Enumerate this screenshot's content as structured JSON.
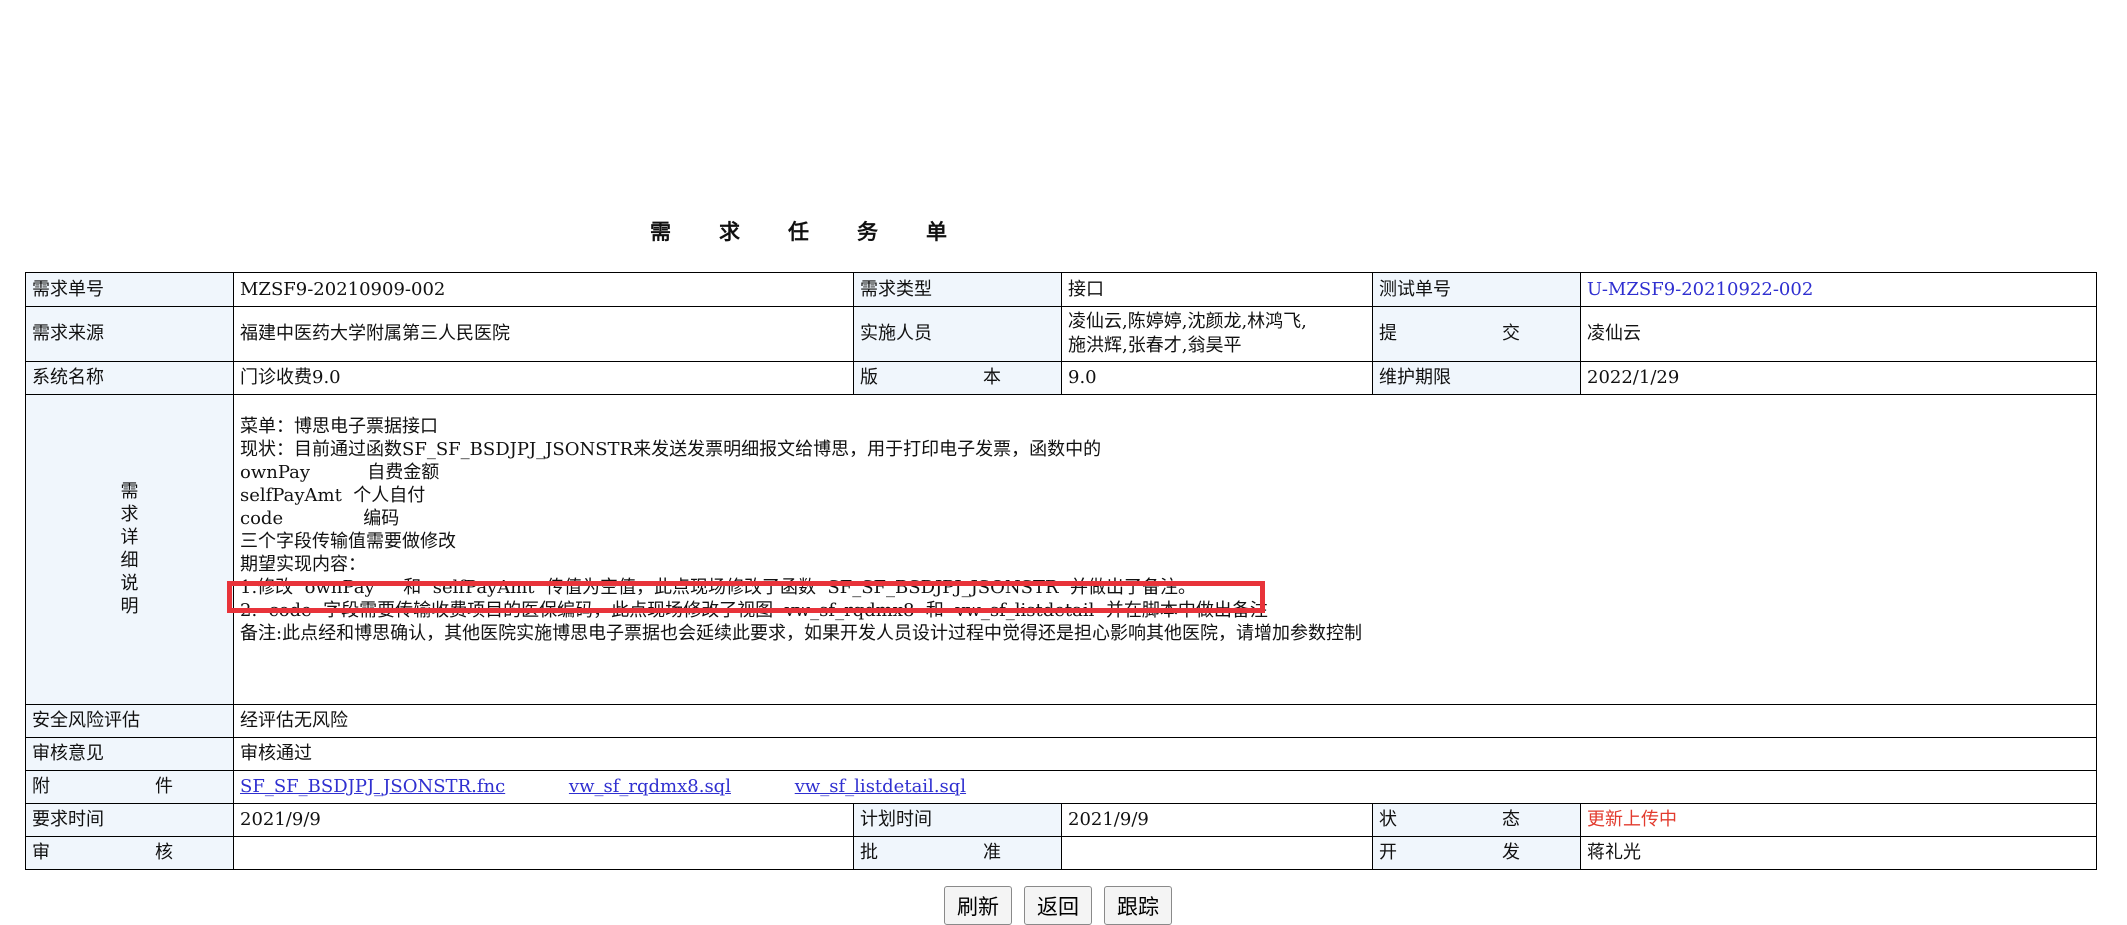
{
  "title": "需求任务单",
  "row1": {
    "req_no_label": "需求单号",
    "req_no": "MZSF9-20210909-002",
    "req_type_label": "需求类型",
    "req_type": "接口",
    "test_no_label": "测试单号",
    "test_no": "U-MZSF9-20210922-002"
  },
  "row2": {
    "source_label": "需求来源",
    "source": "福建中医药大学附属第三人民医院",
    "impl_label": "实施人员",
    "impl_line1": "凌仙云,陈婷婷,沈颜龙,林鸿飞,",
    "impl_line2": "施洪辉,张春才,翁昊平",
    "submit_label": "提交",
    "submit": "凌仙云"
  },
  "row3": {
    "system_label": "系统名称",
    "system": "门诊收费9.0",
    "version_label": "版本",
    "version": "9.0",
    "maint_label": "维护期限",
    "maint": "2022/1/29"
  },
  "detail": {
    "label": "需求详细说明",
    "lines": [
      "菜单：博思电子票据接口",
      "现状：目前通过函数SF_SF_BSDJPJ_JSONSTR来发送发票明细报文给博思，用于打印电子发票，函数中的",
      "ownPay          自费金额",
      "selfPayAmt  个人自付",
      "code              编码",
      "三个字段传输值需要做修改",
      "期望实现内容：",
      "1.修改  ownPay     和  selfPayAmt  传值为空值，此点现场修改了函数  SF_SF_BSDJPJ_JSONSTR  并做出了备注。",
      "2.  code  字段需要传输收费项目的医保编码，此点现场修改了视图  vw_sf_rqdmx8  和  vw_sf_listdetail  并在脚本中做出备注",
      "备注:此点经和博思确认，其他医院实施博思电子票据也会延续此要求，如果开发人员设计过程中觉得还是担心影响其他医院，请增加参数控制"
    ]
  },
  "risk": {
    "label": "安全风险评估",
    "value": "经评估无风险"
  },
  "review": {
    "label": "审核意见",
    "value": "审核通过"
  },
  "attach": {
    "label": "附件",
    "files": [
      "SF_SF_BSDJPJ_JSONSTR.fnc",
      "vw_sf_rqdmx8.sql",
      "vw_sf_listdetail.sql"
    ]
  },
  "row_time": {
    "req_time_label": "要求时间",
    "req_time": "2021/9/9",
    "plan_time_label": "计划时间",
    "plan_time": "2021/9/9",
    "status_label": "状态",
    "status": "更新上传中"
  },
  "row_approve": {
    "audit_label": "审核",
    "audit": "",
    "approve_label": "批准",
    "approve": "",
    "dev_label": "开发",
    "dev": "蒋礼光"
  },
  "buttons": {
    "refresh": "刷新",
    "back": "返回",
    "track": "跟踪"
  },
  "colors": {
    "label_bg": "#f0f6fc",
    "link": "#2f2fd0",
    "status": "#e23b2e",
    "highlight": "#e8333a"
  }
}
